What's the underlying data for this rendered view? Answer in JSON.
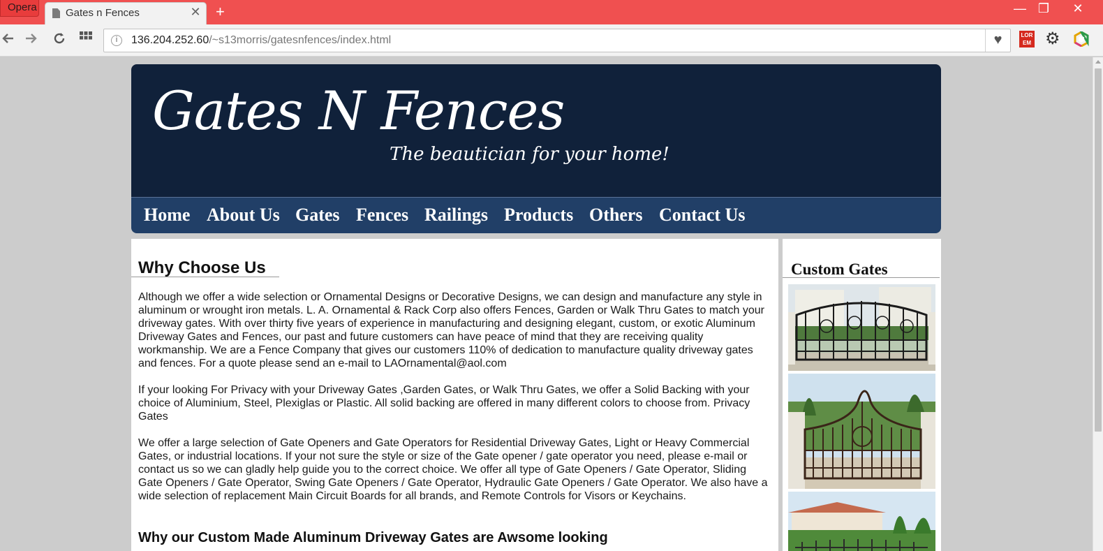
{
  "browser": {
    "menu_label": "Opera",
    "tab_title": "Gates n Fences",
    "tab_close": "✕",
    "new_tab": "+",
    "url_host": "136.204.252.60",
    "url_path": "/~s13morris/gatesnfences/index.html",
    "window_minimize": "—",
    "window_restore": "❐",
    "window_close": "✕",
    "extension_lorem_lines": [
      "LOR",
      "EM"
    ]
  },
  "site": {
    "logo_title": "Gates N Fences",
    "logo_tagline": "The beautician for your home!",
    "nav": [
      "Home",
      "About Us",
      "Gates",
      "Fences",
      "Railings",
      "Products",
      "Others",
      "Contact Us"
    ]
  },
  "main": {
    "heading": "Why Choose Us",
    "paragraphs": [
      "Although we offer a wide selection or Ornamental Designs or Decorative Designs, we can design and manufacture any style in aluminum or wrought iron metals. L. A. Ornamental & Rack Corp also offers Fences, Garden or Walk Thru Gates to match your driveway gates. With over thirty five years of experience in manufacturing and designing elegant, custom, or exotic Aluminum Driveway Gates and Fences, our past and future customers can have peace of mind that they are receiving quality workmanship. We are a Fence Company that gives our customers 110% of dedication to manufacture quality driveway gates and fences. For a quote please send an e-mail to LAOrnamental@aol.com",
      "If your looking For Privacy with your Driveway Gates ,Garden Gates, or Walk Thru Gates, we offer a Solid Backing with your choice of Aluminium, Steel, Plexiglas or Plastic. All solid backing are offered in many different colors to choose from. Privacy Gates",
      "We offer a large selection of Gate Openers and Gate Operators for Residential Driveway Gates, Light or Heavy Commercial Gates, or industrial locations. If your not sure the style or size of the Gate opener / gate operator you need, please e-mail or contact us so we can gladly help guide you to the correct choice. We offer all type of Gate Openers / Gate Operator, Sliding Gate Openers / Gate Operator, Swing Gate Openers / Gate Operator, Hydraulic Gate Openers / Gate Operator. We also have a wide selection of replacement Main Circuit Boards for all brands, and Remote Controls for Visors or Keychains."
    ],
    "subheading": "Why our Custom Made Aluminum Driveway Gates are Awsome looking"
  },
  "sidebar": {
    "heading": "Custom Gates"
  },
  "colors": {
    "titlebar": "#f05050",
    "header_bg": "#10213a",
    "nav_bg": "#213f67",
    "page_bg": "#cccccc"
  }
}
